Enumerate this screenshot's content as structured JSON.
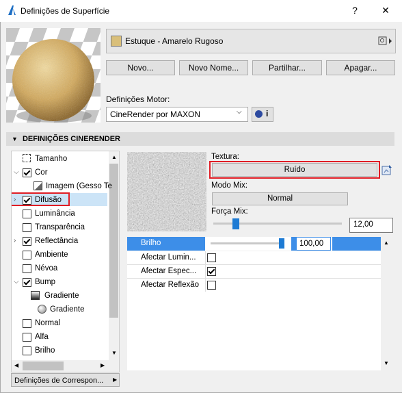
{
  "window": {
    "title": "Definições de Superfície",
    "help": "?",
    "close": "✕"
  },
  "surface": {
    "name": "Estuque - Amarelo Rugoso",
    "swatch_color": "#d9bf7a"
  },
  "buttons": {
    "new": "Novo...",
    "new_name": "Novo Nome...",
    "share": "Partilhar...",
    "delete": "Apagar..."
  },
  "engine": {
    "label": "Definições Motor:",
    "value": "CineRender por MAXON",
    "info": "i"
  },
  "section": {
    "title": "DEFINIÇÕES CINERENDER"
  },
  "tree": [
    {
      "label": "Tamanho",
      "checked": null,
      "icon": "size-icon"
    },
    {
      "label": "Cor",
      "checked": true
    },
    {
      "label": "Imagem (Gesso Te",
      "checked": null,
      "icon": "image-icon"
    },
    {
      "label": "Difusão",
      "checked": true
    },
    {
      "label": "Luminância",
      "checked": false
    },
    {
      "label": "Transparência",
      "checked": false
    },
    {
      "label": "Reflectância",
      "checked": true
    },
    {
      "label": "Ambiente",
      "checked": false
    },
    {
      "label": "Névoa",
      "checked": false
    },
    {
      "label": "Bump",
      "checked": true
    },
    {
      "label": "Gradiente",
      "checked": null,
      "icon": "gradient-icon"
    },
    {
      "label": "Gradiente",
      "checked": null,
      "icon": "sphere-icon"
    },
    {
      "label": "Normal",
      "checked": false
    },
    {
      "label": "Alfa",
      "checked": false
    },
    {
      "label": "Brilho",
      "checked": false
    }
  ],
  "bottom_button": "Definições de Correspon...",
  "texture": {
    "label": "Textura:",
    "value": "Ruído",
    "mix_label": "Modo Mix:",
    "mix_value": "Normal",
    "strength_label": "Força Mix:",
    "strength_value": "12,00",
    "strength_fraction": 0.12
  },
  "props": {
    "brightness": {
      "label": "Brilho",
      "value": "100,00",
      "fraction": 1.0
    },
    "rows": [
      {
        "label": "Afectar Lumin...",
        "checked": false
      },
      {
        "label": "Afectar Espec...",
        "checked": true
      },
      {
        "label": "Afectar Reflexão",
        "checked": false
      }
    ]
  }
}
